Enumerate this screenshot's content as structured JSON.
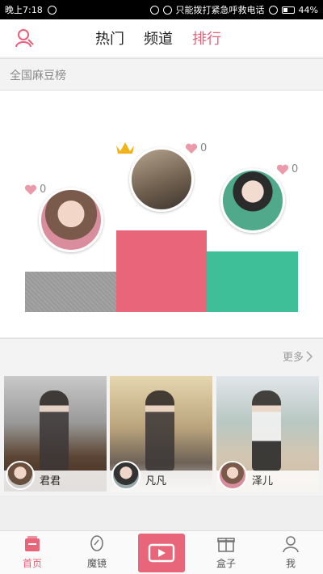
{
  "status_bar": {
    "time": "晚上7:18",
    "carrier_text": "只能拨打紧急呼救电话",
    "battery": "44%"
  },
  "header": {
    "tabs": [
      {
        "label": "热门",
        "active": false
      },
      {
        "label": "频道",
        "active": false
      },
      {
        "label": "排行",
        "active": true
      }
    ]
  },
  "ranking": {
    "title": "全国麻豆榜",
    "podium": [
      {
        "rank": 2,
        "likes": "0"
      },
      {
        "rank": 1,
        "likes": "0"
      },
      {
        "rank": 3,
        "likes": "0"
      }
    ]
  },
  "more_label": "更多",
  "cards": [
    {
      "name": "君君"
    },
    {
      "name": "凡凡"
    },
    {
      "name": "泽儿"
    }
  ],
  "bottom_nav": {
    "items": [
      {
        "label": "首页",
        "icon": "home-icon",
        "active": true
      },
      {
        "label": "魔镜",
        "icon": "mirror-icon",
        "active": false
      },
      {
        "label": "盒子",
        "icon": "gift-box-icon",
        "active": false
      },
      {
        "label": "我",
        "icon": "person-icon",
        "active": false
      }
    ],
    "record_icon": "video-camera-icon"
  },
  "colors": {
    "accent_pink": "#e8657a",
    "accent_green": "#3ebf98",
    "podium_gray": "#999999"
  }
}
